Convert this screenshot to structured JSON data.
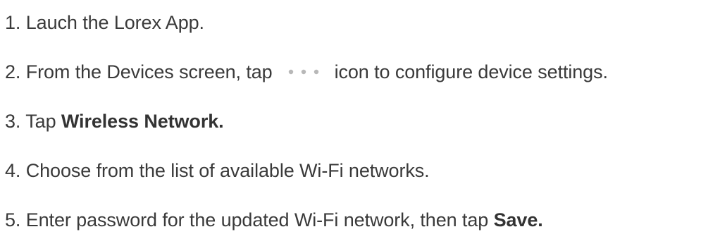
{
  "steps": [
    {
      "number": "1.",
      "text": "Lauch the Lorex App."
    },
    {
      "number": "2.",
      "before_icon": "From the Devices screen, tap",
      "icon": "more-dots-icon",
      "after_icon": "icon to configure device settings."
    },
    {
      "number": "3.",
      "before_bold": "Tap",
      "bold": "Wireless Network."
    },
    {
      "number": "4.",
      "text": "Choose from the list of available Wi-Fi networks."
    },
    {
      "number": "5.",
      "before_bold": "Enter password for the updated Wi-Fi network, then tap",
      "bold": "Save."
    }
  ],
  "colors": {
    "text": "#3a3a3a",
    "icon_dots": "#b8b8b8"
  }
}
